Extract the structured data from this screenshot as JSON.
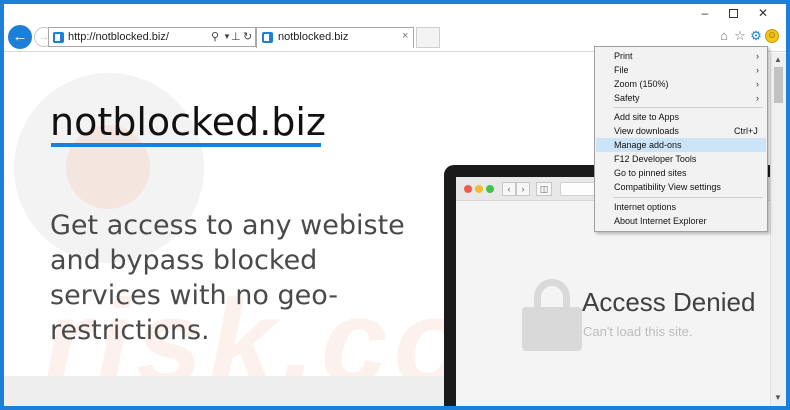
{
  "window": {
    "minimize": "–",
    "close": "✕"
  },
  "navbar": {
    "back": "←",
    "url": "http://notblocked.biz/",
    "tab_title": "notblocked.biz",
    "tab_close": "×",
    "icons": [
      "search-icon",
      "compat-view-icon",
      "refresh-icon",
      "home-icon",
      "star-icon",
      "gear-icon",
      "smiley-icon"
    ]
  },
  "tools_menu": {
    "items": [
      {
        "label": "Print",
        "submenu": true
      },
      {
        "label": "File",
        "submenu": true
      },
      {
        "label": "Zoom (150%)",
        "submenu": true
      },
      {
        "label": "Safety",
        "submenu": true
      },
      {
        "label": "Add site to Apps"
      },
      {
        "label": "View downloads",
        "shortcut": "Ctrl+J"
      },
      {
        "label": "Manage add-ons",
        "highlighted": true
      },
      {
        "label": "F12 Developer Tools"
      },
      {
        "label": "Go to pinned sites"
      },
      {
        "label": "Compatibility View settings"
      },
      {
        "label": "Internet options"
      },
      {
        "label": "About Internet Explorer"
      }
    ]
  },
  "page": {
    "title": "notblocked.biz",
    "tagline": "Get access to any webiste and bypass blocked services with no geo-restrictions.",
    "access_denied": "Access Denied",
    "access_sub": "Can't load this site.",
    "watermark": "risk.com"
  },
  "colors": {
    "accent": "#1c7fd8",
    "menu_highlight": "#cce4f7"
  }
}
